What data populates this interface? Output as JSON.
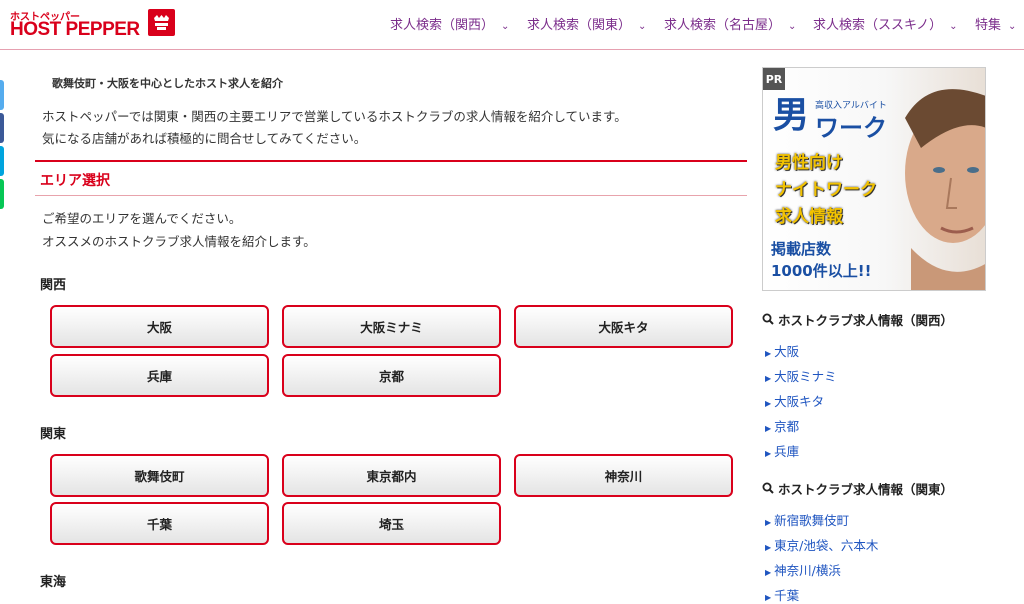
{
  "logo": {
    "small_text": "ホストペッパー",
    "big_text": "HOST PEPPER"
  },
  "nav": [
    {
      "label": "求人検索（関西）"
    },
    {
      "label": "求人検索（関東）"
    },
    {
      "label": "求人検索（名古屋）"
    },
    {
      "label": "求人検索（ススキノ）"
    },
    {
      "label": "特集"
    }
  ],
  "share_colors": [
    "#55acee",
    "#3b5998",
    "#00a4de",
    "#06c755"
  ],
  "breadcrumb": "歌舞伎町・大阪を中心としたホスト求人を紹介",
  "intro": [
    "ホストペッパーでは関東・関西の主要エリアで営業しているホストクラブの求人情報を紹介しています。",
    "気になる店舗があれば積極的に問合せしてみてください。"
  ],
  "section_title": "エリア選択",
  "guide": [
    "ご希望のエリアを選んでください。",
    "オススメのホストクラブ求人情報を紹介します。"
  ],
  "regions": [
    {
      "name": "関西",
      "areas": [
        "大阪",
        "大阪ミナミ",
        "大阪キタ",
        "兵庫",
        "京都"
      ]
    },
    {
      "name": "関東",
      "areas": [
        "歌舞伎町",
        "東京都内",
        "神奈川",
        "千葉",
        "埼玉"
      ]
    },
    {
      "name": "東海",
      "areas": []
    }
  ],
  "ad": {
    "pr": "PR",
    "kanji": "男",
    "sub": "高収入アルバイト",
    "work": "ワーク",
    "lines": [
      "男性向け",
      "ナイトワーク",
      "求人情報"
    ],
    "count": [
      "掲載店数",
      "1000件以上!!"
    ]
  },
  "sidebar": {
    "kansai_title": "ホストクラブ求人情報（関西）",
    "kansai_links": [
      "大阪",
      "大阪ミナミ",
      "大阪キタ",
      "京都",
      "兵庫"
    ],
    "kanto_title": "ホストクラブ求人情報（関東）",
    "kanto_links": [
      "新宿歌舞伎町",
      "東京/池袋、六本木",
      "神奈川/横浜",
      "千葉"
    ]
  },
  "colors": {
    "accent": "#d9001b",
    "nav": "#7b2d8b",
    "link": "#1f55c0"
  }
}
